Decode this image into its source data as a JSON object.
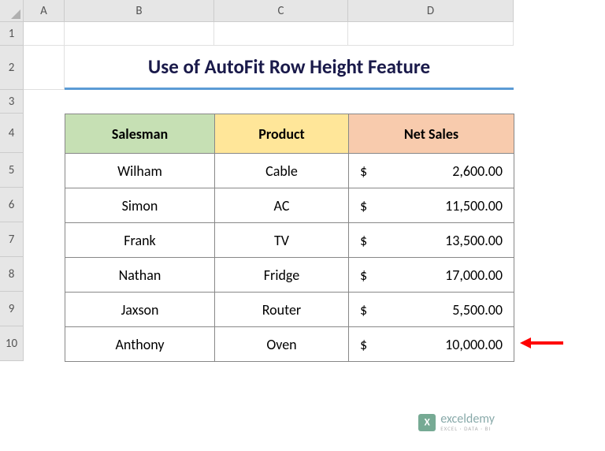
{
  "columns": [
    "A",
    "B",
    "C",
    "D"
  ],
  "rows": [
    "1",
    "2",
    "3",
    "4",
    "5",
    "6",
    "7",
    "8",
    "9",
    "10"
  ],
  "title": "Use of AutoFit Row Height Feature",
  "headers": {
    "salesman": "Salesman",
    "product": "Product",
    "netsales": "Net Sales"
  },
  "currency": "$",
  "data": [
    {
      "salesman": "Wilham",
      "product": "Cable",
      "netsales": "2,600.00"
    },
    {
      "salesman": "Simon",
      "product": "AC",
      "netsales": "11,500.00"
    },
    {
      "salesman": "Frank",
      "product": "TV",
      "netsales": "13,500.00"
    },
    {
      "salesman": "Nathan",
      "product": "Fridge",
      "netsales": "17,000.00"
    },
    {
      "salesman": "Jaxson",
      "product": "Router",
      "netsales": "5,500.00"
    },
    {
      "salesman": "Anthony",
      "product": "Oven",
      "netsales": "10,000.00"
    }
  ],
  "watermark": {
    "main": "exceldemy",
    "sub": "EXCEL · DATA · BI"
  },
  "chart_data": {
    "type": "table",
    "title": "Use of AutoFit Row Height Feature",
    "columns": [
      "Salesman",
      "Product",
      "Net Sales"
    ],
    "rows": [
      [
        "Wilham",
        "Cable",
        2600.0
      ],
      [
        "Simon",
        "AC",
        11500.0
      ],
      [
        "Frank",
        "TV",
        13500.0
      ],
      [
        "Nathan",
        "Fridge",
        17000.0
      ],
      [
        "Jaxson",
        "Router",
        5500.0
      ],
      [
        "Anthony",
        "Oven",
        10000.0
      ]
    ]
  }
}
